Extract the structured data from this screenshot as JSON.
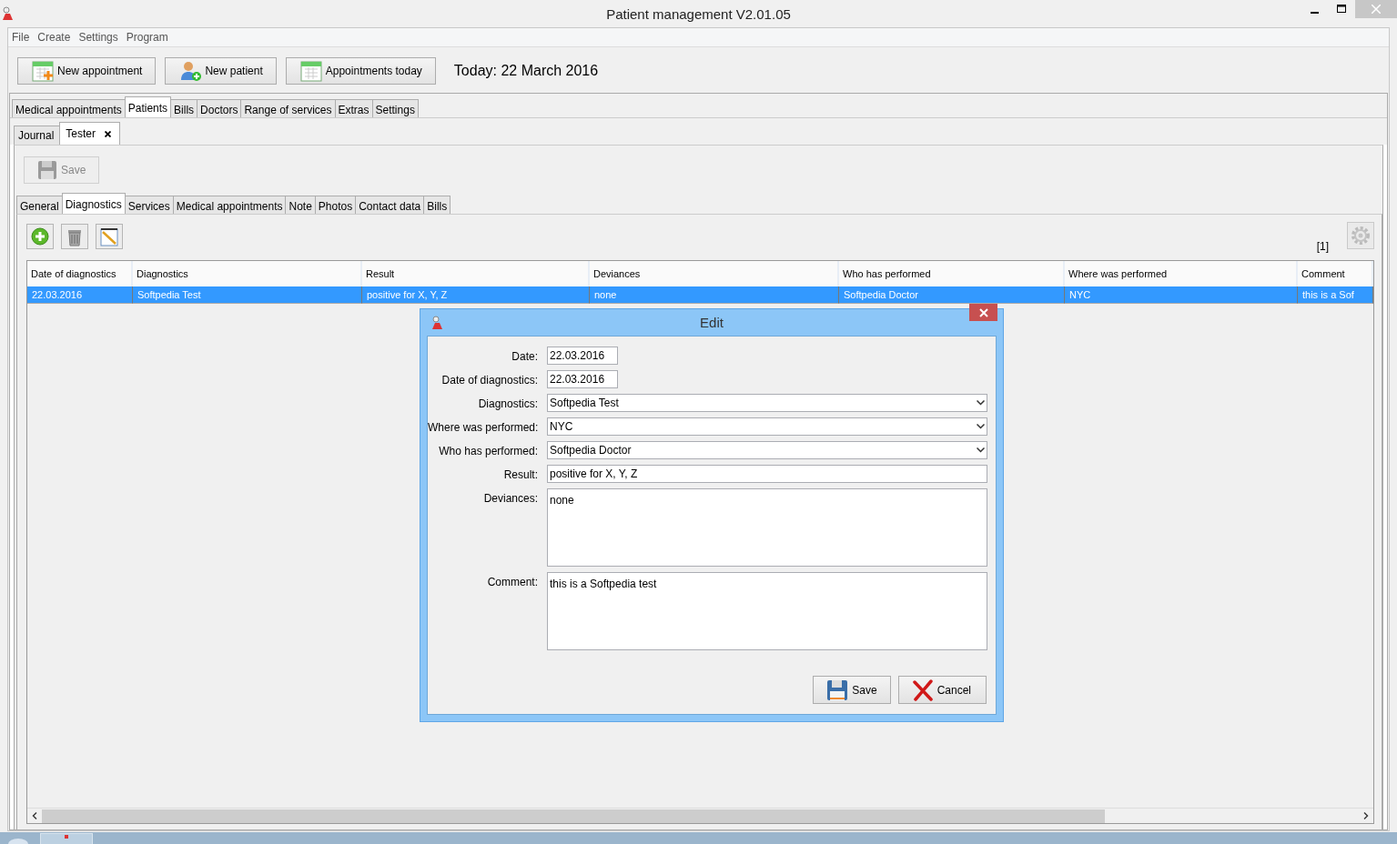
{
  "window": {
    "title": "Patient management V2.01.05"
  },
  "menu": [
    "File",
    "Create",
    "Settings",
    "Program"
  ],
  "toolbar": [
    {
      "label": "New appointment",
      "kind": "appointment"
    },
    {
      "label": "New patient",
      "kind": "patient"
    },
    {
      "label": "Appointments today",
      "kind": "calendar"
    }
  ],
  "today": "Today: 22 March 2016",
  "main_tabs": [
    {
      "label": "Medical appointments",
      "selected": false
    },
    {
      "label": "Patients",
      "selected": true
    },
    {
      "label": "Bills",
      "selected": false
    },
    {
      "label": "Doctors",
      "selected": false
    },
    {
      "label": "Range of services",
      "selected": false
    },
    {
      "label": "Extras",
      "selected": false
    },
    {
      "label": "Settings",
      "selected": false
    }
  ],
  "patient_tabs": [
    {
      "label": "Journal",
      "selected": false,
      "closable": false
    },
    {
      "label": "Tester",
      "selected": true,
      "closable": true
    }
  ],
  "save_button": {
    "label": "Save",
    "disabled": true
  },
  "detail_tabs": [
    {
      "label": "General",
      "selected": false
    },
    {
      "label": "Diagnostics",
      "selected": true
    },
    {
      "label": "Services",
      "selected": false
    },
    {
      "label": "Medical appointments",
      "selected": false
    },
    {
      "label": "Note",
      "selected": false
    },
    {
      "label": "Photos",
      "selected": false
    },
    {
      "label": "Contact data",
      "selected": false
    },
    {
      "label": "Bills",
      "selected": false
    }
  ],
  "record_count": "[1]",
  "table": {
    "columns": [
      "Date of diagnostics",
      "Diagnostics",
      "Result",
      "Deviances",
      "Who has performed",
      "Where was performed",
      "Comment"
    ],
    "rows": [
      {
        "selected": true,
        "cells": [
          "22.03.2016",
          "Softpedia Test",
          "positive for X, Y, Z",
          "none",
          "Softpedia Doctor",
          "NYC",
          "this is a Sof"
        ]
      }
    ]
  },
  "dialog": {
    "title": "Edit",
    "fields": [
      {
        "label": "Date:",
        "value": "22.03.2016",
        "kind": "date"
      },
      {
        "label": "Date of diagnostics:",
        "value": "22.03.2016",
        "kind": "date"
      },
      {
        "label": "Diagnostics:",
        "value": "Softpedia Test",
        "kind": "combo"
      },
      {
        "label": "Where was performed:",
        "value": "NYC",
        "kind": "combo"
      },
      {
        "label": "Who has performed:",
        "value": "Softpedia Doctor",
        "kind": "combo"
      },
      {
        "label": "Result:",
        "value": "positive for X, Y, Z",
        "kind": "text"
      },
      {
        "label": "Deviances:",
        "value": "none",
        "kind": "area"
      },
      {
        "label": "Comment:",
        "value": "this is a Softpedia test",
        "kind": "area"
      }
    ],
    "buttons": [
      {
        "label": "Save",
        "kind": "save"
      },
      {
        "label": "Cancel",
        "kind": "cancel"
      }
    ]
  }
}
